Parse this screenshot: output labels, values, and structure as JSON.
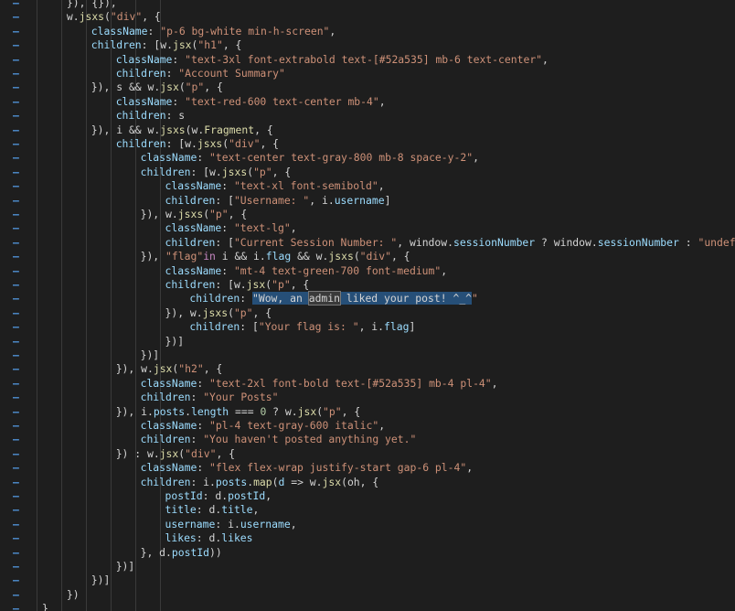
{
  "gutter_mark": "–",
  "lines": [
    [
      [
        "op",
        "}), {}),"
      ]
    ],
    [
      [
        "var",
        "w"
      ],
      [
        "op",
        "."
      ],
      [
        "fn",
        "jsxs"
      ],
      [
        "op",
        "("
      ],
      [
        "str",
        "\"div\""
      ],
      [
        "op",
        ", {"
      ]
    ],
    [
      [
        "prop",
        "className"
      ],
      [
        "op",
        ": "
      ],
      [
        "str",
        "\"p-6 bg-white min-h-screen\""
      ],
      [
        "op",
        ","
      ]
    ],
    [
      [
        "prop",
        "children"
      ],
      [
        "op",
        ": [w."
      ],
      [
        "fn",
        "jsx"
      ],
      [
        "op",
        "("
      ],
      [
        "str",
        "\"h1\""
      ],
      [
        "op",
        ", {"
      ]
    ],
    [
      [
        "prop",
        "className"
      ],
      [
        "op",
        ": "
      ],
      [
        "str",
        "\"text-3xl font-extrabold text-[#52a535] mb-6 text-center\""
      ],
      [
        "op",
        ","
      ]
    ],
    [
      [
        "prop",
        "children"
      ],
      [
        "op",
        ": "
      ],
      [
        "str",
        "\"Account Summary\""
      ]
    ],
    [
      [
        "op",
        "}), s && w."
      ],
      [
        "fn",
        "jsx"
      ],
      [
        "op",
        "("
      ],
      [
        "str",
        "\"p\""
      ],
      [
        "op",
        ", {"
      ]
    ],
    [
      [
        "prop",
        "className"
      ],
      [
        "op",
        ": "
      ],
      [
        "str",
        "\"text-red-600 text-center mb-4\""
      ],
      [
        "op",
        ","
      ]
    ],
    [
      [
        "prop",
        "children"
      ],
      [
        "op",
        ": s"
      ]
    ],
    [
      [
        "op",
        "}), i && w."
      ],
      [
        "fn",
        "jsxs"
      ],
      [
        "op",
        "(w."
      ],
      [
        "fn",
        "Fragment"
      ],
      [
        "op",
        ", {"
      ]
    ],
    [
      [
        "prop",
        "children"
      ],
      [
        "op",
        ": [w."
      ],
      [
        "fn",
        "jsxs"
      ],
      [
        "op",
        "("
      ],
      [
        "str",
        "\"div\""
      ],
      [
        "op",
        ", {"
      ]
    ],
    [
      [
        "prop",
        "className"
      ],
      [
        "op",
        ": "
      ],
      [
        "str",
        "\"text-center text-gray-800 mb-8 space-y-2\""
      ],
      [
        "op",
        ","
      ]
    ],
    [
      [
        "prop",
        "children"
      ],
      [
        "op",
        ": [w."
      ],
      [
        "fn",
        "jsxs"
      ],
      [
        "op",
        "("
      ],
      [
        "str",
        "\"p\""
      ],
      [
        "op",
        ", {"
      ]
    ],
    [
      [
        "prop",
        "className"
      ],
      [
        "op",
        ": "
      ],
      [
        "str",
        "\"text-xl font-semibold\""
      ],
      [
        "op",
        ","
      ]
    ],
    [
      [
        "prop",
        "children"
      ],
      [
        "op",
        ": ["
      ],
      [
        "str",
        "\"Username: \""
      ],
      [
        "op",
        ", i."
      ],
      [
        "prop",
        "username"
      ],
      [
        "op",
        "]"
      ]
    ],
    [
      [
        "op",
        "}), w."
      ],
      [
        "fn",
        "jsxs"
      ],
      [
        "op",
        "("
      ],
      [
        "str",
        "\"p\""
      ],
      [
        "op",
        ", {"
      ]
    ],
    [
      [
        "prop",
        "className"
      ],
      [
        "op",
        ": "
      ],
      [
        "str",
        "\"text-lg\""
      ],
      [
        "op",
        ","
      ]
    ],
    [
      [
        "prop",
        "children"
      ],
      [
        "op",
        ": ["
      ],
      [
        "str",
        "\"Current Session Number: \""
      ],
      [
        "op",
        ", window."
      ],
      [
        "prop",
        "sessionNumber"
      ],
      [
        "op",
        " ? window."
      ],
      [
        "prop",
        "sessionNumber"
      ],
      [
        "op",
        " : "
      ],
      [
        "str",
        "\"undefin"
      ]
    ],
    [
      [
        "op",
        "}), "
      ],
      [
        "str",
        "\"flag\""
      ],
      [
        "kw",
        "in"
      ],
      [
        "op",
        " i && i."
      ],
      [
        "prop",
        "flag"
      ],
      [
        "op",
        " && w."
      ],
      [
        "fn",
        "jsxs"
      ],
      [
        "op",
        "("
      ],
      [
        "str",
        "\"div\""
      ],
      [
        "op",
        ", {"
      ]
    ],
    [
      [
        "prop",
        "className"
      ],
      [
        "op",
        ": "
      ],
      [
        "str",
        "\"mt-4 text-green-700 font-medium\""
      ],
      [
        "op",
        ","
      ]
    ],
    [
      [
        "prop",
        "children"
      ],
      [
        "op",
        ": [w."
      ],
      [
        "fn",
        "jsx"
      ],
      [
        "op",
        "("
      ],
      [
        "str",
        "\"p\""
      ],
      [
        "op",
        ", {"
      ]
    ],
    [
      [
        "prop",
        "children"
      ],
      [
        "op",
        ": "
      ],
      [
        "sel",
        "\"Wow, an "
      ],
      [
        "hl",
        "admin"
      ],
      [
        "sel",
        " liked your post! ^_^"
      ],
      [
        "str",
        "\""
      ]
    ],
    [
      [
        "op",
        "}), w."
      ],
      [
        "fn",
        "jsxs"
      ],
      [
        "op",
        "("
      ],
      [
        "str",
        "\"p\""
      ],
      [
        "op",
        ", {"
      ]
    ],
    [
      [
        "prop",
        "children"
      ],
      [
        "op",
        ": ["
      ],
      [
        "str",
        "\"Your flag is: \""
      ],
      [
        "op",
        ", i."
      ],
      [
        "prop",
        "flag"
      ],
      [
        "op",
        "]"
      ]
    ],
    [
      [
        "op",
        "})]"
      ]
    ],
    [
      [
        "op",
        "})]"
      ]
    ],
    [
      [
        "op",
        "}), w."
      ],
      [
        "fn",
        "jsx"
      ],
      [
        "op",
        "("
      ],
      [
        "str",
        "\"h2\""
      ],
      [
        "op",
        ", {"
      ]
    ],
    [
      [
        "prop",
        "className"
      ],
      [
        "op",
        ": "
      ],
      [
        "str",
        "\"text-2xl font-bold text-[#52a535] mb-4 pl-4\""
      ],
      [
        "op",
        ","
      ]
    ],
    [
      [
        "prop",
        "children"
      ],
      [
        "op",
        ": "
      ],
      [
        "str",
        "\"Your Posts\""
      ]
    ],
    [
      [
        "op",
        "}), i."
      ],
      [
        "prop",
        "posts"
      ],
      [
        "op",
        "."
      ],
      [
        "prop",
        "length"
      ],
      [
        "op",
        " === "
      ],
      [
        "num",
        "0"
      ],
      [
        "op",
        " ? w."
      ],
      [
        "fn",
        "jsx"
      ],
      [
        "op",
        "("
      ],
      [
        "str",
        "\"p\""
      ],
      [
        "op",
        ", {"
      ]
    ],
    [
      [
        "prop",
        "className"
      ],
      [
        "op",
        ": "
      ],
      [
        "str",
        "\"pl-4 text-gray-600 italic\""
      ],
      [
        "op",
        ","
      ]
    ],
    [
      [
        "prop",
        "children"
      ],
      [
        "op",
        ": "
      ],
      [
        "str",
        "\"You haven't posted anything yet.\""
      ]
    ],
    [
      [
        "op",
        "}) : w."
      ],
      [
        "fn",
        "jsx"
      ],
      [
        "op",
        "("
      ],
      [
        "str",
        "\"div\""
      ],
      [
        "op",
        ", {"
      ]
    ],
    [
      [
        "prop",
        "className"
      ],
      [
        "op",
        ": "
      ],
      [
        "str",
        "\"flex flex-wrap justify-start gap-6 pl-4\""
      ],
      [
        "op",
        ","
      ]
    ],
    [
      [
        "prop",
        "children"
      ],
      [
        "op",
        ": i."
      ],
      [
        "prop",
        "posts"
      ],
      [
        "op",
        "."
      ],
      [
        "fn",
        "map"
      ],
      [
        "op",
        "("
      ],
      [
        "prop",
        "d"
      ],
      [
        "op",
        " => w."
      ],
      [
        "fn",
        "jsx"
      ],
      [
        "op",
        "(oh, {"
      ]
    ],
    [
      [
        "prop",
        "postId"
      ],
      [
        "op",
        ": d."
      ],
      [
        "prop",
        "postId"
      ],
      [
        "op",
        ","
      ]
    ],
    [
      [
        "prop",
        "title"
      ],
      [
        "op",
        ": d."
      ],
      [
        "prop",
        "title"
      ],
      [
        "op",
        ","
      ]
    ],
    [
      [
        "prop",
        "username"
      ],
      [
        "op",
        ": i."
      ],
      [
        "prop",
        "username"
      ],
      [
        "op",
        ","
      ]
    ],
    [
      [
        "prop",
        "likes"
      ],
      [
        "op",
        ": d."
      ],
      [
        "prop",
        "likes"
      ]
    ],
    [
      [
        "op",
        "}, d."
      ],
      [
        "prop",
        "postId"
      ],
      [
        "op",
        "))"
      ]
    ],
    [
      [
        "op",
        "})]"
      ]
    ],
    [
      [
        "op",
        "})]"
      ]
    ],
    [
      [
        "op",
        "})"
      ]
    ],
    [
      [
        "op",
        "}"
      ]
    ]
  ]
}
